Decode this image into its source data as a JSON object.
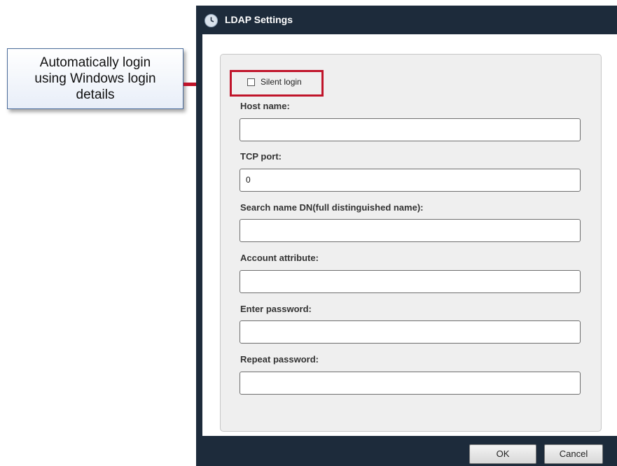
{
  "callout": {
    "text": "Automatically login\nusing Windows login\ndetails"
  },
  "dialog": {
    "title": "LDAP Settings",
    "silent_login_label": "Silent login",
    "silent_login_checked": false,
    "fields": [
      {
        "label": "Host name:",
        "value": ""
      },
      {
        "label": "TCP port:",
        "value": "0"
      },
      {
        "label": "Search name DN(full distinguished name):",
        "value": ""
      },
      {
        "label": "Account attribute:",
        "value": ""
      },
      {
        "label": "Enter password:",
        "value": ""
      },
      {
        "label": "Repeat password:",
        "value": ""
      }
    ],
    "buttons": {
      "ok": "OK",
      "cancel": "Cancel"
    }
  },
  "colors": {
    "titlebar": "#1d2b3b",
    "annotation_red": "#c0142a",
    "panel_bg": "#efefef"
  }
}
